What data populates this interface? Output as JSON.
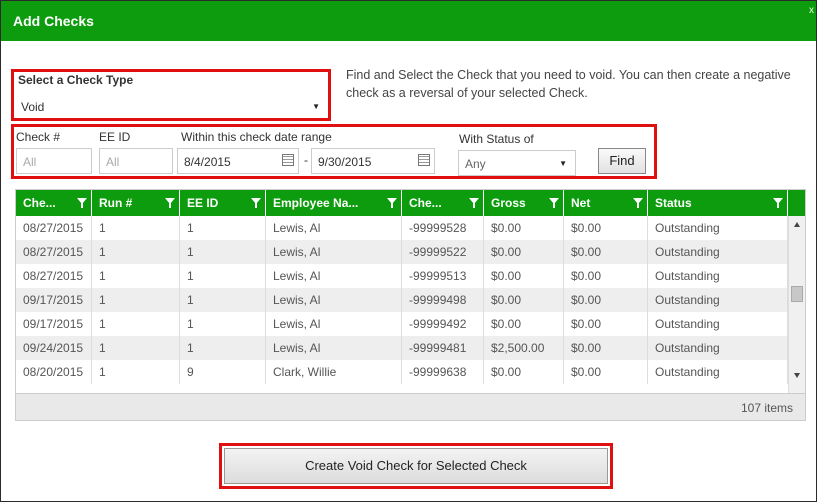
{
  "dialog": {
    "title": "Add Checks",
    "close_glyph": "x",
    "description": "Find and Select the Check that you need to void. You can then create a negative check as a reversal of your selected Check."
  },
  "check_type": {
    "label": "Select a Check Type",
    "value": "Void"
  },
  "filters": {
    "check_number": {
      "label": "Check #",
      "placeholder": "All"
    },
    "ee_id": {
      "label": "EE ID",
      "placeholder": "All"
    },
    "date_range": {
      "label": "Within this check date range",
      "from": "8/4/2015",
      "separator": "-",
      "to": "9/30/2015"
    },
    "status": {
      "label": "With Status of",
      "value": "Any"
    },
    "find_label": "Find"
  },
  "grid": {
    "columns": [
      "Che...",
      "Run #",
      "EE ID",
      "Employee Na...",
      "Che...",
      "Gross",
      "Net",
      "Status"
    ],
    "rows": [
      [
        "08/27/2015",
        "1",
        "1",
        "Lewis, Al",
        "-99999528",
        "$0.00",
        "$0.00",
        "Outstanding"
      ],
      [
        "08/27/2015",
        "1",
        "1",
        "Lewis, Al",
        "-99999522",
        "$0.00",
        "$0.00",
        "Outstanding"
      ],
      [
        "08/27/2015",
        "1",
        "1",
        "Lewis, Al",
        "-99999513",
        "$0.00",
        "$0.00",
        "Outstanding"
      ],
      [
        "09/17/2015",
        "1",
        "1",
        "Lewis, Al",
        "-99999498",
        "$0.00",
        "$0.00",
        "Outstanding"
      ],
      [
        "09/17/2015",
        "1",
        "1",
        "Lewis, Al",
        "-99999492",
        "$0.00",
        "$0.00",
        "Outstanding"
      ],
      [
        "09/24/2015",
        "1",
        "1",
        "Lewis, Al",
        "-99999481",
        "$2,500.00",
        "$0.00",
        "Outstanding"
      ],
      [
        "08/20/2015",
        "1",
        "9",
        "Clark, Willie",
        "-99999638",
        "$0.00",
        "$0.00",
        "Outstanding"
      ]
    ],
    "item_count": "107 items"
  },
  "actions": {
    "create_void_label": "Create Void Check for Selected Check"
  },
  "colors": {
    "header_green": "#0d9c0d",
    "highlight_red": "#e01010"
  }
}
